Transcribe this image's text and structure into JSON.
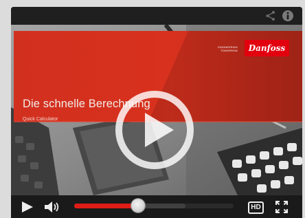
{
  "icons": {
    "share": "share-icon",
    "info": "info-icon",
    "play_overlay": "play-circle-icon",
    "play": "play-icon",
    "volume": "volume-icon",
    "fullscreen": "fullscreen-icon"
  },
  "video": {
    "title": "Die schnelle Berechnung",
    "subtitle": "Quick Calculator",
    "tagline": "ENGINEERING TOMORROW",
    "brand": "Danfoss"
  },
  "controls": {
    "hd_label": "HD",
    "progress_fraction": 0.4,
    "buffered_fraction": 0.7
  },
  "colors": {
    "accent": "#e01c16",
    "banner": "#d8321f",
    "brand_red": "#e2000f"
  }
}
